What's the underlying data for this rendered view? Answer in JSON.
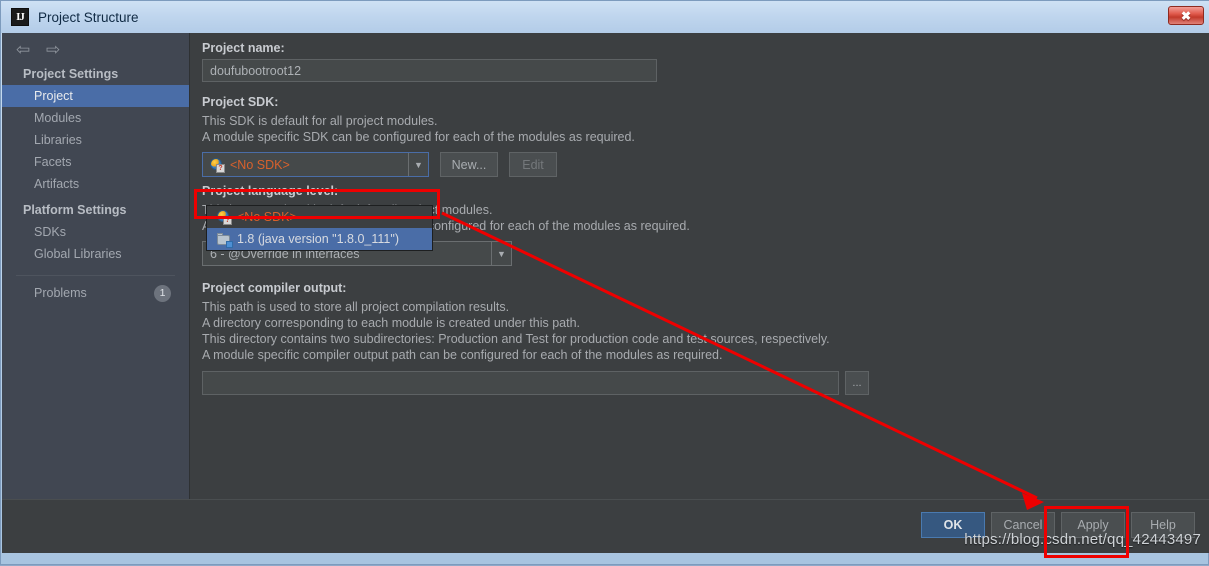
{
  "window": {
    "title": "Project Structure",
    "logo_text": "IJ",
    "close_label": "✖"
  },
  "nav": {
    "back_icon": "⇦",
    "forward_icon": "⇨"
  },
  "sidebar": {
    "groups": [
      {
        "label": "Project Settings",
        "items": [
          {
            "label": "Project",
            "selected": true
          },
          {
            "label": "Modules",
            "selected": false
          },
          {
            "label": "Libraries",
            "selected": false
          },
          {
            "label": "Facets",
            "selected": false
          },
          {
            "label": "Artifacts",
            "selected": false
          }
        ]
      },
      {
        "label": "Platform Settings",
        "items": [
          {
            "label": "SDKs",
            "selected": false
          },
          {
            "label": "Global Libraries",
            "selected": false
          }
        ]
      }
    ],
    "problems": {
      "label": "Problems",
      "count": "1"
    }
  },
  "main": {
    "project_name": {
      "label": "Project name:",
      "value": "doufubootroot12"
    },
    "project_sdk": {
      "label": "Project SDK:",
      "desc_line1": "This SDK is default for all project modules.",
      "desc_line2": "A module specific SDK can be configured for each of the modules as required.",
      "selected": "<No SDK>",
      "new_button": "New...",
      "edit_button": "Edit",
      "options": [
        {
          "label": "<No SDK>",
          "icon": "no-sdk-icon",
          "selected": false
        },
        {
          "label": "1.8 (java version \"1.8.0_111\")",
          "icon": "folder-icon",
          "selected": true
        }
      ]
    },
    "language_level": {
      "label": "Project language level:",
      "desc_line1": "This language level is default for all project modules.",
      "desc_line2": "A module specific language level can be configured for each of the modules as required.",
      "selected": "6 - @Override in interfaces"
    },
    "compiler_output": {
      "label": "Project compiler output:",
      "desc_line1": "This path is used to store all project compilation results.",
      "desc_line2": "A directory corresponding to each module is created under this path.",
      "desc_line3": "This directory contains two subdirectories: Production and Test for production code and test sources, respectively.",
      "desc_line4": "A module specific compiler output path can be configured for each of the modules as required.",
      "value": "",
      "browse_button": "..."
    }
  },
  "footer": {
    "buttons": [
      {
        "label": "OK",
        "primary": true
      },
      {
        "label": "Cancel",
        "primary": false
      },
      {
        "label": "Apply",
        "primary": false
      },
      {
        "label": "Help",
        "primary": false
      }
    ],
    "watermark": "https://blog.csdn.net/qq_42443497"
  },
  "annotations": {
    "accent_color": "#ee0000",
    "highlight_sdk_option": true,
    "highlight_apply_button": true
  }
}
